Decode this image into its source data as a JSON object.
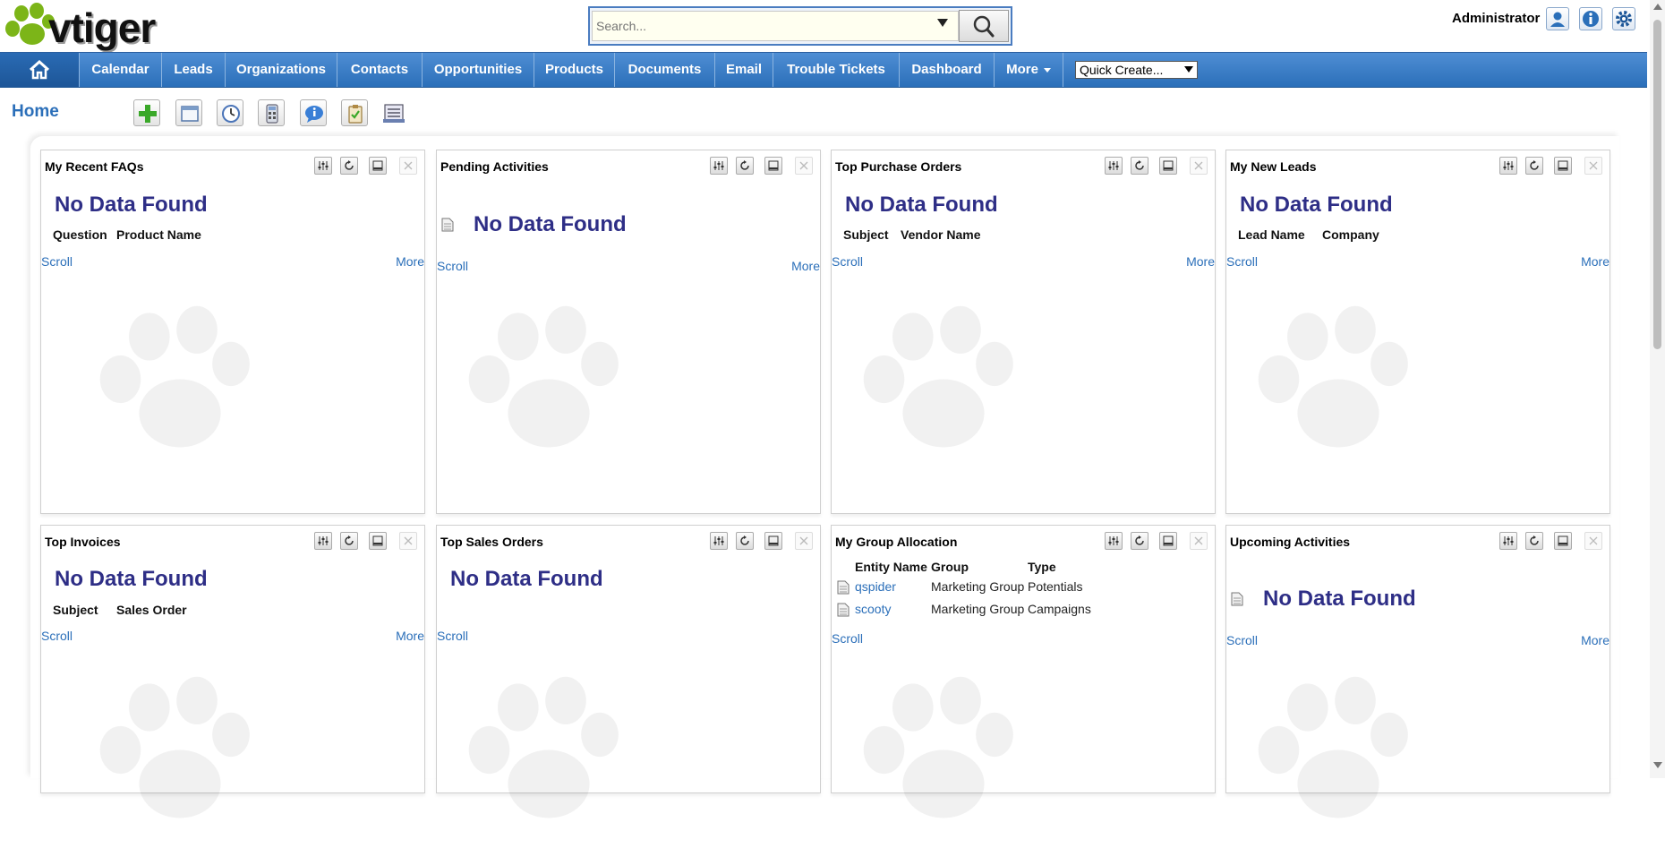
{
  "app": {
    "logo_text": "vtiger"
  },
  "search": {
    "placeholder": "Search..."
  },
  "header": {
    "user": "Administrator",
    "icons": [
      "user-profile-icon",
      "info-icon",
      "settings-gear-icon"
    ]
  },
  "nav": {
    "items": [
      "Calendar",
      "Leads",
      "Organizations",
      "Contacts",
      "Opportunities",
      "Products",
      "Documents",
      "Email",
      "Trouble Tickets",
      "Dashboard",
      "More"
    ],
    "quick_create": "Quick Create..."
  },
  "page": {
    "title": "Home",
    "toolbar_icons": [
      "add-widget-icon",
      "window-icon",
      "clock-icon",
      "calculator-icon",
      "chat-icon",
      "clipboard-icon",
      "notebook-icon"
    ]
  },
  "widgets": [
    {
      "title": "My Recent FAQs",
      "empty": "No Data Found",
      "columns": [
        "Question",
        "Product Name"
      ],
      "scroll": "Scroll",
      "more": "More"
    },
    {
      "title": "Pending Activities",
      "empty": "No Data Found",
      "scroll": "Scroll",
      "more": "More"
    },
    {
      "title": "Top Purchase Orders",
      "empty": "No Data Found",
      "columns": [
        "Subject",
        "Vendor Name"
      ],
      "scroll": "Scroll",
      "more": "More"
    },
    {
      "title": "My New Leads",
      "empty": "No Data Found",
      "columns": [
        "Lead Name",
        "Company"
      ],
      "scroll": "Scroll",
      "more": "More"
    },
    {
      "title": "Top Invoices",
      "empty": "No Data Found",
      "columns": [
        "Subject",
        "Sales Order"
      ],
      "scroll": "Scroll",
      "more": "More"
    },
    {
      "title": "Top Sales Orders",
      "empty": "No Data Found",
      "scroll": "Scroll"
    },
    {
      "title": "My Group Allocation",
      "columns": [
        "Entity Name",
        "Group",
        "Type"
      ],
      "rows": [
        {
          "name": "qspider",
          "group": "Marketing Group",
          "type": "Potentials"
        },
        {
          "name": "scooty",
          "group": "Marketing Group",
          "type": "Campaigns"
        }
      ],
      "scroll": "Scroll"
    },
    {
      "title": "Upcoming Activities",
      "empty": "No Data Found",
      "scroll": "Scroll",
      "more": "More"
    }
  ],
  "colors": {
    "nav_blue": "#2b6fb9",
    "nodata": "#2e2e86",
    "link": "#2b6fb9",
    "logo_green": "#7cb518"
  }
}
